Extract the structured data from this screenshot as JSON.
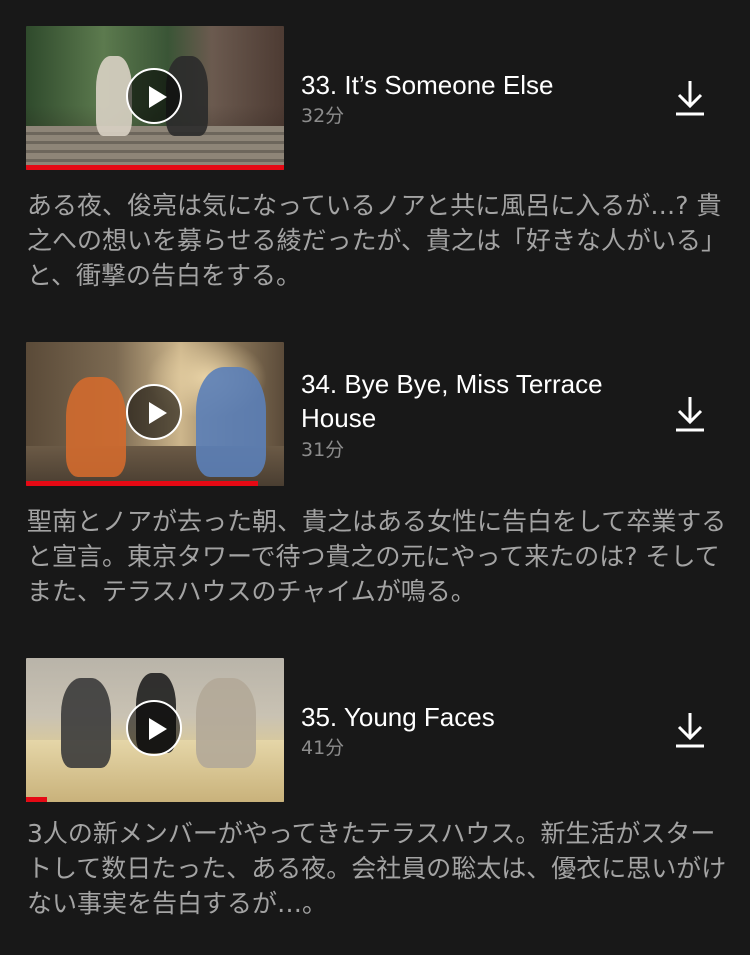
{
  "episodes": [
    {
      "title": "33. It’s Someone Else",
      "duration": "32分",
      "synopsis": "ある夜、俊亮は気になっているノアと共に風呂に入るが…? 貴之への想いを募らせる綾だったが、貴之は「好きな人がいる」と、衝撃の告白をする。",
      "progress_fraction": 1.0
    },
    {
      "title": "34. Bye Bye, Miss Terrace House",
      "duration": "31分",
      "synopsis": "聖南とノアが去った朝、貴之はある女性に告白をして卒業すると宣言。東京タワーで待つ貴之の元にやって来たのは? そしてまた、テラスハウスのチャイムが鳴る。",
      "progress_fraction": 0.9
    },
    {
      "title": "35. Young Faces",
      "duration": "41分",
      "synopsis": "3人の新メンバーがやってきたテラスハウス。新生活がスタートして数日たった、ある夜。会社員の聡太は、優衣に思いがけない事実を告白するが…。",
      "progress_fraction": 0.08
    }
  ],
  "icons": {
    "play": "play-icon",
    "download": "download-icon"
  },
  "colors": {
    "background": "#181818",
    "progress": "#e50914",
    "title": "#ffffff",
    "meta": "#8c8c8c",
    "synopsis": "#a3a3a3"
  }
}
